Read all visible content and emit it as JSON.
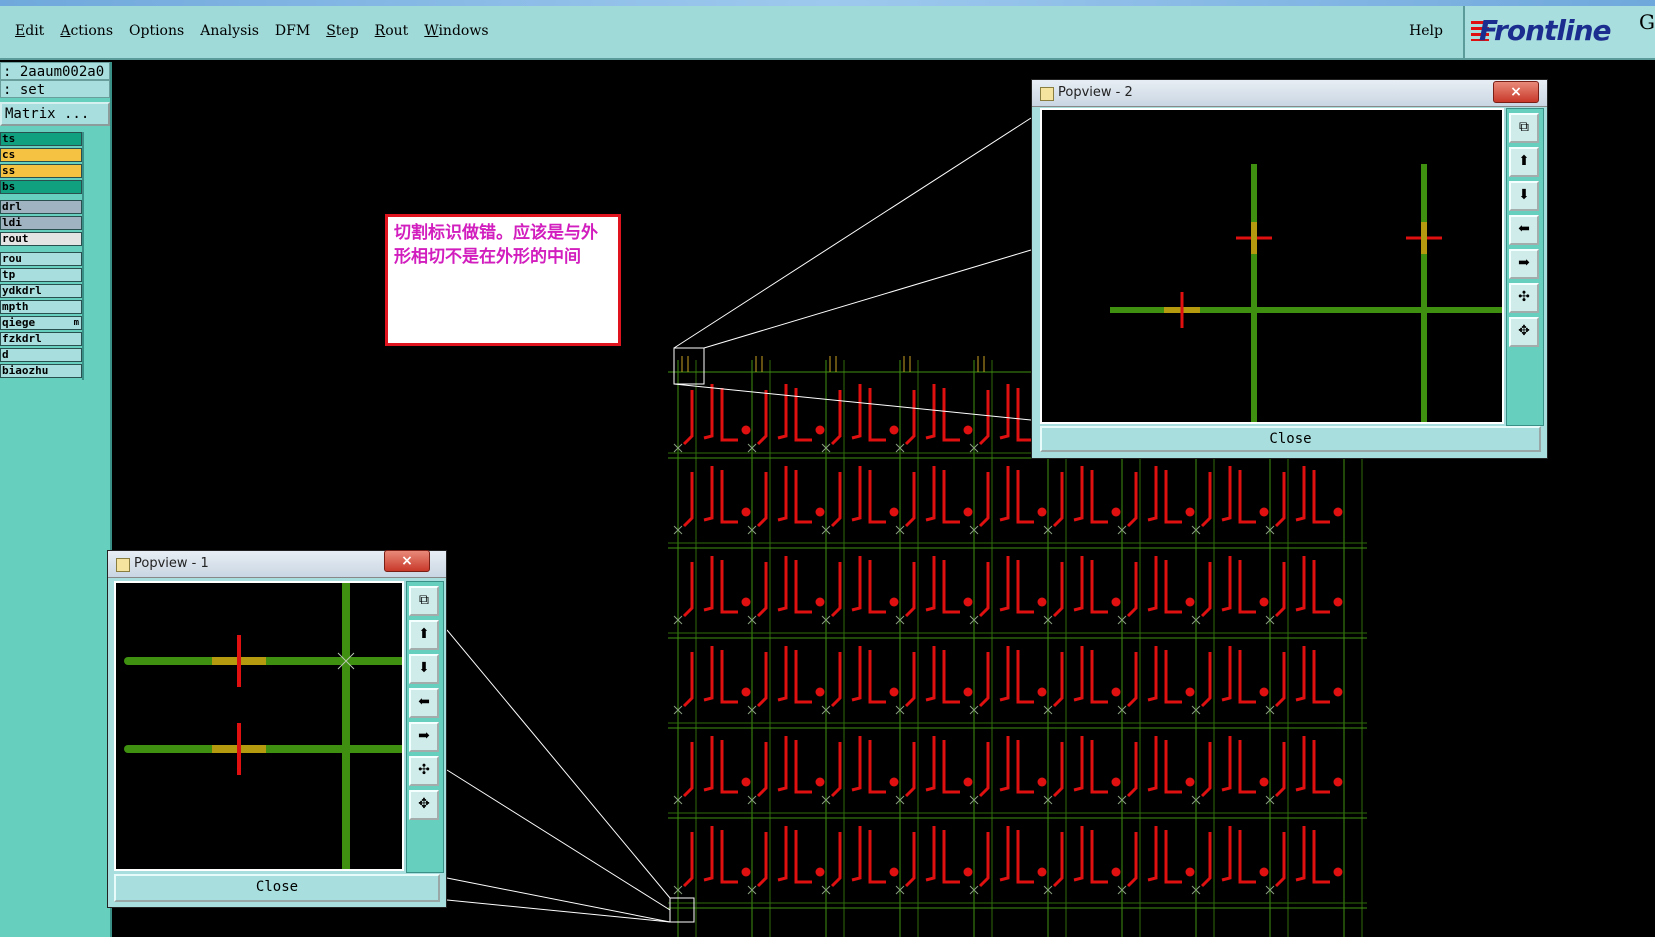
{
  "menu": {
    "items": [
      "Edit",
      "Actions",
      "Options",
      "Analysis",
      "DFM",
      "Step",
      "Rout",
      "Windows"
    ],
    "help": "Help"
  },
  "brand": {
    "logo": "Frontline",
    "tail": "G"
  },
  "left_panel": {
    "job_field": ": 2aaum002a0",
    "step_field": ": set",
    "matrix_button": "Matrix ...",
    "layers": [
      {
        "name": "ts",
        "color": "#10a080"
      },
      {
        "name": "cs",
        "color": "#f5c242"
      },
      {
        "name": "ss",
        "color": "#f5c242"
      },
      {
        "name": "bs",
        "color": "#10a080"
      },
      {
        "name": "drl",
        "color": "#9fb4c0"
      },
      {
        "name": "ldi",
        "color": "#9fb4c0"
      },
      {
        "name": "rout",
        "color": "#e4e4e4"
      },
      {
        "name": "rou",
        "color": "#a8dedd"
      },
      {
        "name": "tp",
        "color": "#a8dedd"
      },
      {
        "name": "ydkdrl",
        "color": "#a8dedd"
      },
      {
        "name": "mpth",
        "color": "#a8dedd"
      },
      {
        "name": "qiege",
        "color": "#a8dedd",
        "marker": "m"
      },
      {
        "name": "fzkdrl",
        "color": "#a8dedd"
      },
      {
        "name": "d",
        "color": "#a8dedd"
      },
      {
        "name": "biaozhu",
        "color": "#a8dedd"
      }
    ]
  },
  "annotation": {
    "text": "切割标识做错。应该是与外形相切不是在外形的中间",
    "border_color": "#e0141e",
    "text_color": "#d21ebe"
  },
  "popview1": {
    "title": "Popview - 1",
    "close_label": "Close",
    "x_label": "×"
  },
  "popview2": {
    "title": "Popview - 2",
    "close_label": "Close",
    "x_label": "×"
  },
  "toolbar_icons": [
    "zoom-fit-icon",
    "pan-up-icon",
    "pan-down-icon",
    "pan-left-icon",
    "pan-right-icon",
    "zoom-in-icon",
    "zoom-out-icon"
  ],
  "colors": {
    "trace": "#e01010",
    "outline": "#3f8f10",
    "background": "#000000"
  }
}
